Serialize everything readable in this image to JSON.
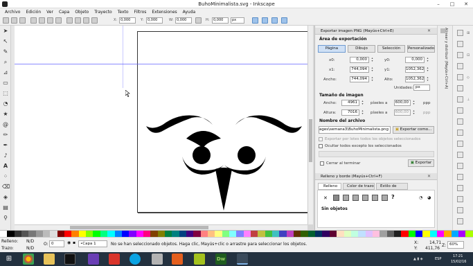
{
  "window": {
    "title": "BuhoMinimalista.svg - Inkscape",
    "minimize": "–",
    "maximize": "□",
    "close": "✕"
  },
  "menu": [
    "Archivo",
    "Edición",
    "Ver",
    "Capa",
    "Objeto",
    "Trayecto",
    "Texto",
    "Filtros",
    "Extensiones",
    "Ayuda"
  ],
  "toolbar": {
    "x_label": "X:",
    "x_value": "0,000",
    "y_label": "Y:",
    "y_value": "0,000",
    "w_label": "W:",
    "w_value": "0,000",
    "h_label": "H:",
    "h_value": "0,000",
    "unit": "px"
  },
  "export_panel": {
    "title": "Exportar imagen PNG (Mayús+Ctrl+E)",
    "area_heading": "Área de exportación",
    "area_buttons": [
      "Página",
      "Dibujo",
      "Selección",
      "Personalizado"
    ],
    "active_area": "Página",
    "x0_label": "x0:",
    "x0": "0,000",
    "y0_label": "y0:",
    "y0": "0,000",
    "x1_label": "x1:",
    "x1": "744,094",
    "y1_label": "y1:",
    "y1": "1052,362",
    "width_label": "Ancho:",
    "width": "744,094",
    "height_label": "Alto:",
    "height": "1052,362",
    "units_label": "Unidades:",
    "units": "px",
    "size_heading": "Tamaño de imagen",
    "img_width_label": "Ancho:",
    "img_width": "4961",
    "pixels_at": "píxeles a",
    "dpi_w": "600,00",
    "dpi_unit": "ppp",
    "img_height_label": "Altura:",
    "img_height": "7016",
    "dpi_h": "600,00",
    "filename_heading": "Nombre del archivo",
    "filename": "ages\\semana3\\BuhoMinimalista.png",
    "export_as_button": "Exportar como...",
    "batch_label": "Exportar por lotes todos los objetos seleccionados",
    "hide_label": "Ocultar todos excepto los seleccionados",
    "close_when_done": "Cerrar al terminar",
    "export_button": "Exportar"
  },
  "fill_panel": {
    "title": "Relleno y borde (Mayús+Ctrl+F)",
    "tabs": [
      "Relleno",
      "Color de trazo",
      "Estilo de trazo"
    ],
    "none_label": "Sin objetos"
  },
  "side_tab": "Alinear y distribuir (Mayús+Ctrl+A)",
  "status": {
    "fill_label": "Relleno:",
    "fill_value": "N/D",
    "stroke_label": "Trazo:",
    "stroke_value": "N/D",
    "opacity_label": "O:",
    "opacity_value": "0",
    "layer": "•Capa 1",
    "message": "No se han seleccionado objetos. Haga clic, Mayús+clic o arrastre para seleccionar los objetos.",
    "x_label": "X:",
    "x_value": "14,71",
    "y_label": "Y:",
    "y_value": "411,76",
    "zoom_label": "Z:",
    "zoom": "60%"
  },
  "taskbar": {
    "lang": "ESP",
    "time": "17:21",
    "date": "15/02/16"
  },
  "colors": {
    "accent": "#3778c7",
    "guide": "#5a5aff",
    "taskbar": "#23313f"
  }
}
